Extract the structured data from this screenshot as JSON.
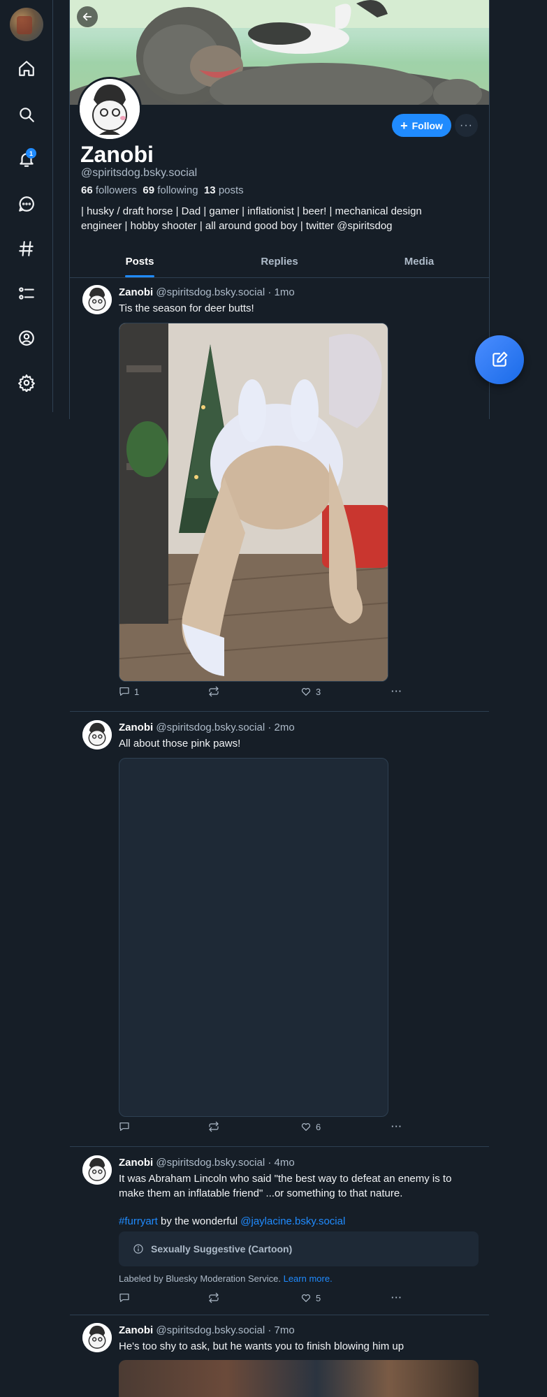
{
  "profile": {
    "display_name": "Zanobi",
    "handle": "@spiritsdog.bsky.social",
    "followers_count": "66",
    "followers_label": "followers",
    "following_count": "69",
    "following_label": "following",
    "posts_count": "13",
    "posts_label": "posts",
    "bio_line1": "| husky / draft horse | Dad | gamer | inflationist | beer! | mechanical design",
    "bio_line2": "engineer | hobby shooter | all around good boy | twitter @spiritsdog",
    "follow_label": "Follow",
    "more_label": "···"
  },
  "nav": {
    "notification_count": "1"
  },
  "tabs": [
    "Posts",
    "Replies",
    "Media"
  ],
  "posts": [
    {
      "author": "Zanobi",
      "meta": "@spiritsdog.bsky.social · 1mo",
      "text": "Tis the season for deer butts!",
      "replies": "1",
      "reposts": "",
      "likes": "3"
    },
    {
      "author": "Zanobi",
      "meta": "@spiritsdog.bsky.social · 2mo",
      "text": "All about those pink paws!",
      "replies": "",
      "reposts": "",
      "likes": "6"
    },
    {
      "author": "Zanobi",
      "meta": "@spiritsdog.bsky.social · 4mo",
      "text_line1": "It was Abraham Lincoln who said \"the best way to defeat an enemy is to",
      "text_line2": "make them an inflatable friend\" ...or something to that nature.",
      "hashtag": "#furryart",
      "by_text": "by the wonderful",
      "mention": "@jaylacine.bsky.social",
      "warning": "Sexually Suggestive (Cartoon)",
      "label_text": "Labeled by Bluesky Moderation Service.",
      "learn_more": "Learn more.",
      "replies": "",
      "reposts": "",
      "likes": "5"
    },
    {
      "author": "Zanobi",
      "meta": "@spiritsdog.bsky.social · 7mo",
      "text": "He's too shy to ask, but he wants you to finish blowing him up"
    }
  ],
  "colors": {
    "background": "#161e27",
    "accent": "#208bfe",
    "muted_text": "#aebbc9",
    "border": "#2e4052"
  }
}
